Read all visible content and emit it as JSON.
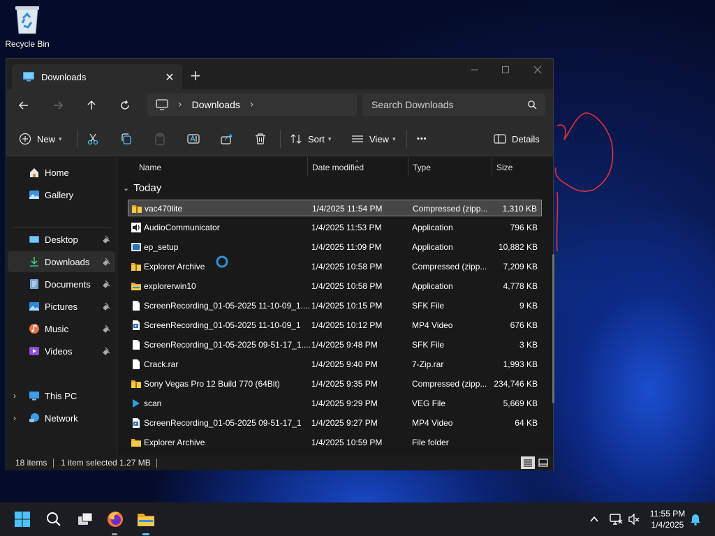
{
  "desktop": {
    "recycle_bin_label": "Recycle Bin"
  },
  "window": {
    "tab_title": "Downloads",
    "new_tab_label": "+",
    "close_tab_glyph": "✕"
  },
  "navigation": {
    "breadcrumb": "Downloads",
    "search_placeholder": "Search Downloads"
  },
  "toolbar": {
    "new_label": "New",
    "sort_label": "Sort",
    "view_label": "View",
    "more_label": "•••",
    "details_label": "Details"
  },
  "sidebar": {
    "items": [
      {
        "label": "Home",
        "icon": "home-icon"
      },
      {
        "label": "Gallery",
        "icon": "gallery-icon"
      },
      {
        "label": "Desktop",
        "icon": "desktop-icon",
        "pinned": true
      },
      {
        "label": "Downloads",
        "icon": "download-icon",
        "pinned": true,
        "selected": true
      },
      {
        "label": "Documents",
        "icon": "documents-icon",
        "pinned": true
      },
      {
        "label": "Pictures",
        "icon": "pictures-icon",
        "pinned": true
      },
      {
        "label": "Music",
        "icon": "music-icon",
        "pinned": true
      },
      {
        "label": "Videos",
        "icon": "videos-icon",
        "pinned": true
      },
      {
        "label": "This PC",
        "icon": "this-pc-icon"
      },
      {
        "label": "Network",
        "icon": "network-icon"
      }
    ]
  },
  "file_list": {
    "columns": [
      "Name",
      "Date modified",
      "Type",
      "Size"
    ],
    "group_label": "Today",
    "rows": [
      {
        "name": "vac470lite",
        "date": "1/4/2025 11:54 PM",
        "type": "Compressed (zipp...",
        "size": "1,310 KB",
        "icon": "zip-folder-icon",
        "selected": true
      },
      {
        "name": "AudioCommunicator",
        "date": "1/4/2025 11:53 PM",
        "type": "Application",
        "size": "796 KB",
        "icon": "audio-app-icon"
      },
      {
        "name": "ep_setup",
        "date": "1/4/2025 11:09 PM",
        "type": "Application",
        "size": "10,882 KB",
        "icon": "setup-app-icon"
      },
      {
        "name": "Explorer Archive",
        "date": "1/4/2025 10:58 PM",
        "type": "Compressed (zipp...",
        "size": "7,209 KB",
        "icon": "zip-folder-icon"
      },
      {
        "name": "explorerwin10",
        "date": "1/4/2025 10:58 PM",
        "type": "Application",
        "size": "4,778 KB",
        "icon": "explorer-app-icon"
      },
      {
        "name": "ScreenRecording_01-05-2025 11-10-09_1....",
        "date": "1/4/2025 10:15 PM",
        "type": "SFK File",
        "size": "9 KB",
        "icon": "file-icon"
      },
      {
        "name": "ScreenRecording_01-05-2025 11-10-09_1",
        "date": "1/4/2025 10:12 PM",
        "type": "MP4 Video",
        "size": "676 KB",
        "icon": "video-file-icon"
      },
      {
        "name": "ScreenRecording_01-05-2025 09-51-17_1....",
        "date": "1/4/2025 9:48 PM",
        "type": "SFK File",
        "size": "3 KB",
        "icon": "file-icon"
      },
      {
        "name": "Crack.rar",
        "date": "1/4/2025 9:40 PM",
        "type": "7-Zip.rar",
        "size": "1,993 KB",
        "icon": "file-icon"
      },
      {
        "name": "Sony Vegas Pro 12 Build 770 (64Bit)",
        "date": "1/4/2025 9:35 PM",
        "type": "Compressed (zipp...",
        "size": "234,746 KB",
        "icon": "zip-folder-icon"
      },
      {
        "name": "scan",
        "date": "1/4/2025 9:29 PM",
        "type": "VEG File",
        "size": "5,669 KB",
        "icon": "play-file-icon"
      },
      {
        "name": "ScreenRecording_01-05-2025 09-51-17_1",
        "date": "1/4/2025 9:27 PM",
        "type": "MP4 Video",
        "size": "64 KB",
        "icon": "video-file-icon"
      },
      {
        "name": "Explorer Archive",
        "date": "1/4/2025 10:59 PM",
        "type": "File folder",
        "size": "",
        "icon": "folder-icon"
      }
    ]
  },
  "status": {
    "item_count": "18 items",
    "selection": "1 item selected  1.27 MB"
  },
  "taskbar": {
    "time": "11:55 PM",
    "date": "1/4/2025"
  },
  "colors": {
    "accent": "#4cc2ff",
    "folder": "#f4c24a",
    "window_bg": "#191919",
    "annotation": "#e0303a"
  }
}
